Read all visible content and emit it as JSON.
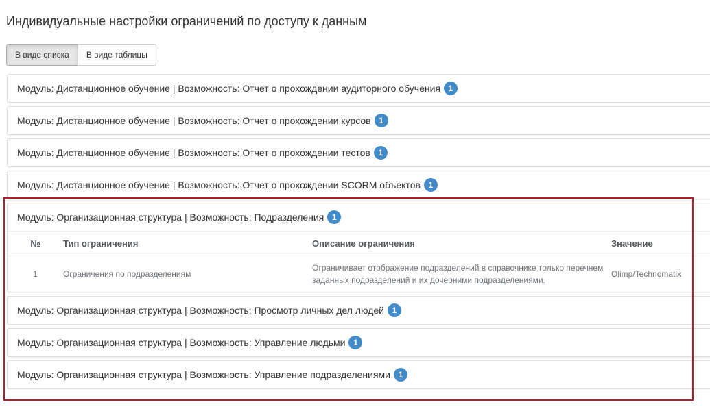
{
  "page": {
    "title": "Индивидуальные настройки ограничений по доступу к данным"
  },
  "view_toggle": {
    "list_label": "В виде списка",
    "table_label": "В виде таблицы",
    "active": "list"
  },
  "panels": [
    {
      "label": "Модуль: Дистанционное обучение | Возможность: Отчет о прохождении аудиторного обучения",
      "count": "1"
    },
    {
      "label": "Модуль: Дистанционное обучение | Возможность: Отчет о прохождении курсов",
      "count": "1"
    },
    {
      "label": "Модуль: Дистанционное обучение | Возможность: Отчет о прохождении тестов",
      "count": "1"
    },
    {
      "label": "Модуль: Дистанционное обучение | Возможность: Отчет о прохождении SCORM объектов",
      "count": "1"
    },
    {
      "label": "Модуль: Организационная структура | Возможность: Подразделения",
      "count": "1",
      "expanded": true
    },
    {
      "label": "Модуль: Организационная структура | Возможность: Просмотр личных дел людей",
      "count": "1"
    },
    {
      "label": "Модуль: Организационная структура | Возможность: Управление людьми",
      "count": "1"
    },
    {
      "label": "Модуль: Организационная структура | Возможность: Управление подразделениями",
      "count": "1"
    }
  ],
  "restrictions_table": {
    "headers": {
      "num": "№",
      "type": "Тип ограничения",
      "description": "Описание ограничения",
      "value": "Значение"
    },
    "rows": [
      {
        "num": "1",
        "type": "Ограничения по подразделениям",
        "description": "Ограничивает отображение подразделений в справочнике только перечнем заданных подразделений и их дочерними подразделениями.",
        "value": "Olimp/Technomatix"
      }
    ]
  },
  "colors": {
    "badge": "#428bca",
    "highlight_frame": "#b71c2c",
    "panel_border": "#dddddd"
  }
}
